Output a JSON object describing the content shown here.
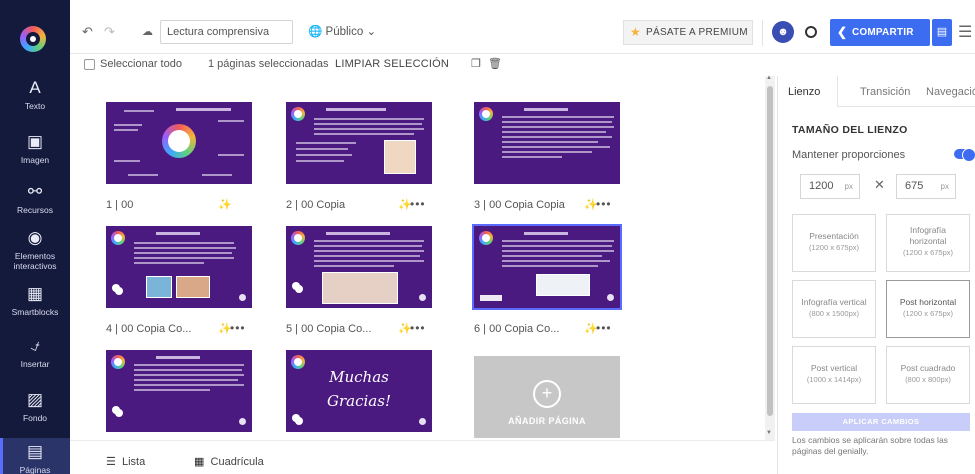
{
  "sidebar": {
    "items": [
      {
        "label": "Texto",
        "icon": "A"
      },
      {
        "label": "Imagen",
        "icon": "🖼"
      },
      {
        "label": "Recursos",
        "icon": "⚇"
      },
      {
        "label": "Elementos interactivos",
        "icon": "◉"
      },
      {
        "label": "Smartblocks",
        "icon": "▦"
      },
      {
        "label": "Insertar",
        "icon": "⎗"
      },
      {
        "label": "Fondo",
        "icon": "▨"
      },
      {
        "label": "Páginas",
        "icon": "▤"
      }
    ]
  },
  "topbar": {
    "title": "Lectura comprensiva",
    "visibility": "Público",
    "premium_label": "PÁSATE A PREMIUM",
    "share_label": "COMPARTIR"
  },
  "selection": {
    "select_all": "Seleccionar todo",
    "count": "1 páginas seleccionadas",
    "clear": "LIMPIAR SELECCIÓN"
  },
  "slides": [
    {
      "caption": "1 | 00"
    },
    {
      "caption": "2 | 00 Copia"
    },
    {
      "caption": "3 | 00 Copia Copia"
    },
    {
      "caption": "4 | 00 Copia Co..."
    },
    {
      "caption": "5 | 00 Copia Co..."
    },
    {
      "caption": "6 | 00 Copia Co..."
    },
    {
      "caption": ""
    },
    {
      "caption": "",
      "text_line1": "Muchas",
      "text_line2": "Gracias!"
    }
  ],
  "add_page": "AÑADIR PÁGINA",
  "bottom": {
    "list": "Lista",
    "grid": "Cuadrícula"
  },
  "panel": {
    "tabs": [
      "Lienzo",
      "Transición",
      "Navegación"
    ],
    "canvas_size_title": "TAMAÑO DEL LIENZO",
    "keep_proportions": "Mantener proporciones",
    "width": "1200",
    "height": "675",
    "unit": "px",
    "formats": [
      {
        "name": "Presentación",
        "size": "(1200 x 675px)"
      },
      {
        "name": "Infografía horizontal",
        "size": "(1200 x 675px)"
      },
      {
        "name": "Infografía vertical",
        "size": "(800 x 1500px)"
      },
      {
        "name": "Post horizontal",
        "size": "(1200 x 675px)"
      },
      {
        "name": "Post vertical",
        "size": "(1000 x 1414px)"
      },
      {
        "name": "Post cuadrado",
        "size": "(800 x 800px)"
      }
    ],
    "apply": "APLICAR CAMBIOS",
    "note": "Los cambios se aplicarán sobre todas las páginas del genially."
  },
  "colors": {
    "sidebar_bg": "#141a3c",
    "slide_bg": "#4b1a80",
    "accent": "#3c6df0",
    "premium_star": "#f6b23d"
  }
}
